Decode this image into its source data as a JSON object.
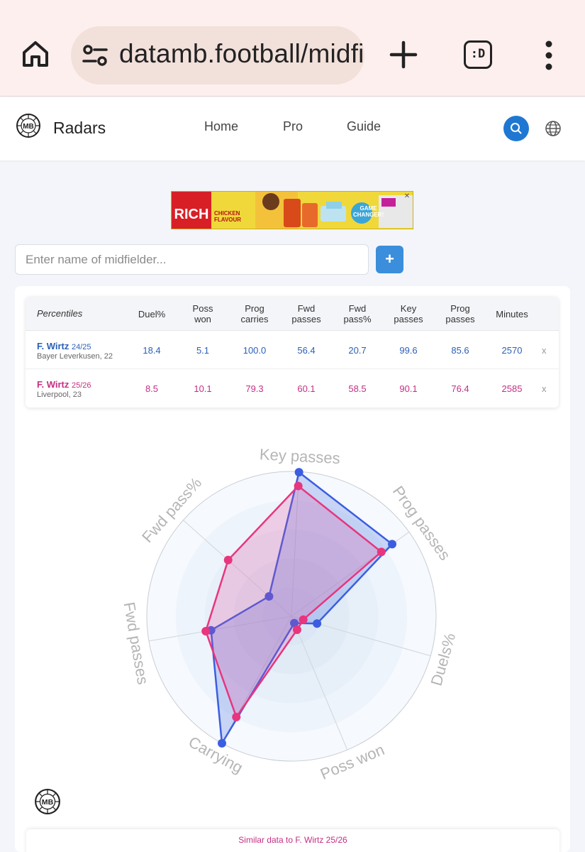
{
  "browser": {
    "url": "datamb.football/midfie",
    "tab_icon_text": ":D"
  },
  "header": {
    "brand": "Radars",
    "nav": [
      "Home",
      "Pro",
      "Guide"
    ],
    "accent": "#1e78d2"
  },
  "ad": {
    "brand_text": "RICH",
    "tagline_line1": "CHICKEN",
    "tagline_line2": "FLAVOUR",
    "badge_line1": "GAME",
    "badge_line2": "CHANGER!",
    "close": "✕"
  },
  "search": {
    "placeholder": "Enter name of midfielder...",
    "add_label": "+"
  },
  "table": {
    "first_header": "Percentiles",
    "columns": [
      "Duel%",
      "Poss won",
      "Prog carries",
      "Fwd passes",
      "Fwd pass%",
      "Key passes",
      "Prog passes",
      "Minutes"
    ],
    "rows": [
      {
        "name": "F. Wirtz",
        "season": "24/25",
        "team": "Bayer Leverkusen, 22",
        "values": [
          "18.4",
          "5.1",
          "100.0",
          "56.4",
          "20.7",
          "99.6",
          "85.6",
          "2570"
        ],
        "color": "#2b5fb8",
        "remove": "x"
      },
      {
        "name": "F. Wirtz",
        "season": "25/26",
        "team": "Liverpool, 23",
        "values": [
          "8.5",
          "10.1",
          "79.3",
          "60.1",
          "58.5",
          "90.1",
          "76.4",
          "2585"
        ],
        "color": "#c42f84",
        "remove": "x"
      }
    ]
  },
  "chart_data": {
    "type": "radar",
    "axes": [
      "Key passes",
      "Prog passes",
      "Duels%",
      "Poss won",
      "Carrying",
      "Fwd passes",
      "Fwd pass%"
    ],
    "range": [
      0,
      100
    ],
    "series": [
      {
        "name": "F. Wirtz 24/25",
        "color": "#3b5ee0",
        "values": [
          99.6,
          85.6,
          18.4,
          5.1,
          100.0,
          56.4,
          20.7
        ]
      },
      {
        "name": "F. Wirtz 25/26",
        "color": "#e8357e",
        "values": [
          90.1,
          76.4,
          8.5,
          10.1,
          79.3,
          60.1,
          58.5
        ]
      }
    ]
  },
  "similar": {
    "title": "Similar data to F. Wirtz 25/26"
  }
}
